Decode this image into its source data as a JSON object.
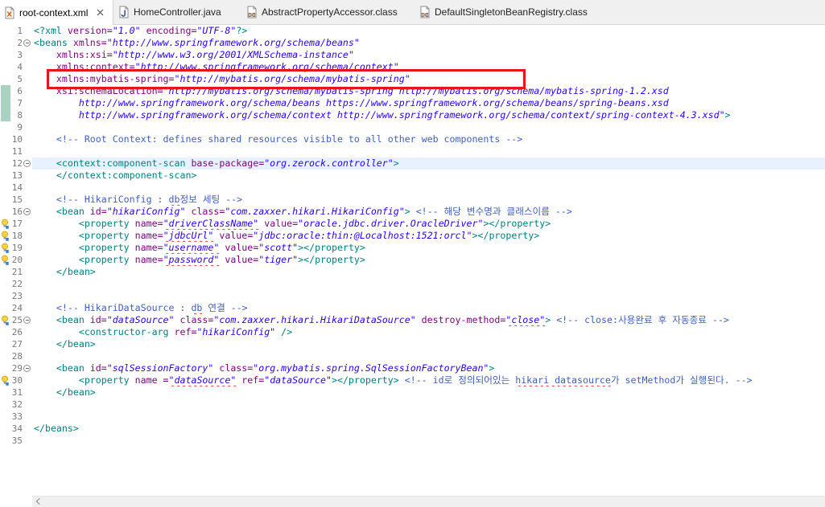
{
  "tabs": [
    {
      "label": "root-context.xml",
      "icon": "xml-file-icon",
      "active": true,
      "close_icon": "close-icon"
    },
    {
      "label": "HomeController.java",
      "icon": "java-file-icon",
      "active": false
    },
    {
      "label": "AbstractPropertyAccessor.class",
      "icon": "class-file-icon",
      "active": false
    },
    {
      "label": "DefaultSingletonBeanRegistry.class",
      "icon": "class-file-icon",
      "active": false
    }
  ],
  "editor": {
    "colors": {
      "tag": "#008080",
      "attr": "#7F007F",
      "value": "#2A00FF",
      "comment": "#3F5FBF",
      "line_number": "#787878",
      "current_line": "#E8F2FE",
      "spelling": "#D8443A",
      "quick_diff": "#A9D2C1",
      "annotation_box": "#E8141B"
    },
    "lines": [
      {
        "n": 1,
        "tokens": [
          {
            "tag": "<?xml"
          },
          {
            "attr": " version="
          },
          {
            "value": "\"1.0\""
          },
          {
            "attr": " encoding="
          },
          {
            "value": "\"UTF-8\""
          },
          {
            "tag": "?>"
          }
        ]
      },
      {
        "n": 2,
        "fold": true,
        "tokens": [
          {
            "tag": "<beans"
          },
          {
            "attr": " xmlns="
          },
          {
            "value": "\"http://www.springframework.org/schema/beans\""
          }
        ]
      },
      {
        "n": 3,
        "tokens": [
          {
            "attr": "    xmlns:xsi="
          },
          {
            "value": "\"http://www.w3.org/2001/XMLSchema-instance\""
          }
        ]
      },
      {
        "n": 4,
        "tokens": [
          {
            "attr": "    xmlns:context="
          },
          {
            "value": "\"http://www.springframework.org/schema/context\""
          }
        ]
      },
      {
        "n": 5,
        "tokens": [
          {
            "attr": "    xmlns:mybatis-spring="
          },
          {
            "value": "\"http://mybatis.org/schema/mybatis-spring\""
          }
        ]
      },
      {
        "n": 6,
        "changed": true,
        "tokens": [
          {
            "attr": "    xsi:schemaLocation="
          },
          {
            "value": "\"http://mybatis.org/schema/mybatis-spring http://mybatis.org/schema/mybatis-spring-1.2.xsd"
          }
        ]
      },
      {
        "n": 7,
        "changed": true,
        "tokens": [
          {
            "value": "        http://www.springframework.org/schema/beans https://www.springframework.org/schema/beans/spring-beans.xsd"
          }
        ]
      },
      {
        "n": 8,
        "changed": true,
        "tokens": [
          {
            "value": "        http://www.springframework.org/schema/context http://www.springframework.org/schema/context/spring-context-4.3.xsd\""
          },
          {
            "tag": ">"
          }
        ]
      },
      {
        "n": 9,
        "tokens": []
      },
      {
        "n": 10,
        "tokens": [
          {
            "comment": "    <!-- Root Context: defines shared resources visible to all other web components -->"
          }
        ]
      },
      {
        "n": 11,
        "tokens": []
      },
      {
        "n": 12,
        "fold": true,
        "current": true,
        "tokens": [
          {
            "tag": "    <context:component-scan"
          },
          {
            "attr": " base-package="
          },
          {
            "value": "\"org.zerock.controller\""
          },
          {
            "tag": ">"
          }
        ]
      },
      {
        "n": 13,
        "tokens": [
          {
            "tag": "    </context:component-scan>"
          }
        ]
      },
      {
        "n": 14,
        "tokens": []
      },
      {
        "n": 15,
        "tokens": [
          {
            "comment": "    <!-- HikariConfig : "
          },
          {
            "comment": "db",
            "spell": true
          },
          {
            "comment": "정보 세팅 -->"
          }
        ]
      },
      {
        "n": 16,
        "fold": true,
        "tokens": [
          {
            "tag": "    <bean"
          },
          {
            "attr": " id="
          },
          {
            "value": "\"hikariConfig\""
          },
          {
            "attr": " class="
          },
          {
            "value": "\"com.zaxxer.hikari.HikariConfig\""
          },
          {
            "tag": ">"
          },
          {
            "comment": " <!-- 해당 변수명과 클래스이름 -->"
          }
        ]
      },
      {
        "n": 17,
        "marker": "lightbulb-icon",
        "tokens": [
          {
            "tag": "        <property"
          },
          {
            "attr": " name="
          },
          {
            "value": "\"driverClassName\"",
            "spell": true
          },
          {
            "attr": " value="
          },
          {
            "value": "\"oracle.jdbc.driver.OracleDriver\""
          },
          {
            "tag": "></property>"
          }
        ]
      },
      {
        "n": 18,
        "marker": "lightbulb-icon",
        "tokens": [
          {
            "tag": "        <property"
          },
          {
            "attr": " name="
          },
          {
            "value": "\"jdbcUrl\"",
            "spell": true
          },
          {
            "attr": " value="
          },
          {
            "value": "\"jdbc:oracle:thin:@Localhost:1521:orcl\""
          },
          {
            "tag": "></property>"
          }
        ]
      },
      {
        "n": 19,
        "marker": "lightbulb-icon",
        "tokens": [
          {
            "tag": "        <property"
          },
          {
            "attr": " name="
          },
          {
            "value": "\"username\"",
            "spell": true
          },
          {
            "attr": " value="
          },
          {
            "value": "\"scott\""
          },
          {
            "tag": "></property>"
          }
        ]
      },
      {
        "n": 20,
        "marker": "lightbulb-icon",
        "tokens": [
          {
            "tag": "        <property"
          },
          {
            "attr": " name="
          },
          {
            "value": "\"password\"",
            "spell": true
          },
          {
            "attr": " value="
          },
          {
            "value": "\"tiger\""
          },
          {
            "tag": "></property>"
          }
        ]
      },
      {
        "n": 21,
        "tokens": [
          {
            "tag": "    </bean>"
          }
        ]
      },
      {
        "n": 22,
        "tokens": []
      },
      {
        "n": 23,
        "tokens": []
      },
      {
        "n": 24,
        "tokens": [
          {
            "comment": "    <!-- HikariDataSource : "
          },
          {
            "comment": "db",
            "spell": true
          },
          {
            "comment": " 연결 -->"
          }
        ]
      },
      {
        "n": 25,
        "fold": true,
        "marker": "lightbulb-icon",
        "tokens": [
          {
            "tag": "    <bean"
          },
          {
            "attr": " id="
          },
          {
            "value": "\"dataSource\""
          },
          {
            "attr": " class="
          },
          {
            "value": "\"com.zaxxer.hikari.HikariDataSource\""
          },
          {
            "attr": " destroy-method="
          },
          {
            "value": "\"close\"",
            "spell": true
          },
          {
            "tag": ">"
          },
          {
            "comment": " <!-- close:사용완료 후 자동종료 -->"
          }
        ]
      },
      {
        "n": 26,
        "tokens": [
          {
            "tag": "        <constructor-arg"
          },
          {
            "attr": " ref="
          },
          {
            "value": "\"hikariConfig\""
          },
          {
            "tag": " />"
          }
        ]
      },
      {
        "n": 27,
        "tokens": [
          {
            "tag": "    </bean>"
          }
        ]
      },
      {
        "n": 28,
        "tokens": []
      },
      {
        "n": 29,
        "fold": true,
        "tokens": [
          {
            "tag": "    <bean"
          },
          {
            "attr": " id="
          },
          {
            "value": "\"sqlSessionFactory\""
          },
          {
            "attr": " class="
          },
          {
            "value": "\"org.mybatis.spring.SqlSessionFactoryBean\""
          },
          {
            "tag": ">"
          }
        ]
      },
      {
        "n": 30,
        "marker": "lightbulb-icon",
        "tokens": [
          {
            "tag": "        <property"
          },
          {
            "attr": " name ="
          },
          {
            "value": "\"dataSource\"",
            "spell": true
          },
          {
            "attr": " ref="
          },
          {
            "value": "\"dataSource\""
          },
          {
            "tag": "></property>"
          },
          {
            "comment": " <!-- id로 정의되어있는 "
          },
          {
            "comment": "hikari datasource",
            "spell": true
          },
          {
            "comment": "가 setMethod가 실행된다. -->"
          }
        ]
      },
      {
        "n": 31,
        "tokens": [
          {
            "tag": "    </bean>"
          }
        ]
      },
      {
        "n": 32,
        "tokens": []
      },
      {
        "n": 33,
        "tokens": []
      },
      {
        "n": 34,
        "tokens": [
          {
            "tag": "</beans>"
          }
        ]
      },
      {
        "n": 35,
        "tokens": []
      }
    ]
  },
  "scrollbar": {
    "left_icon": "chevron-left-icon"
  }
}
